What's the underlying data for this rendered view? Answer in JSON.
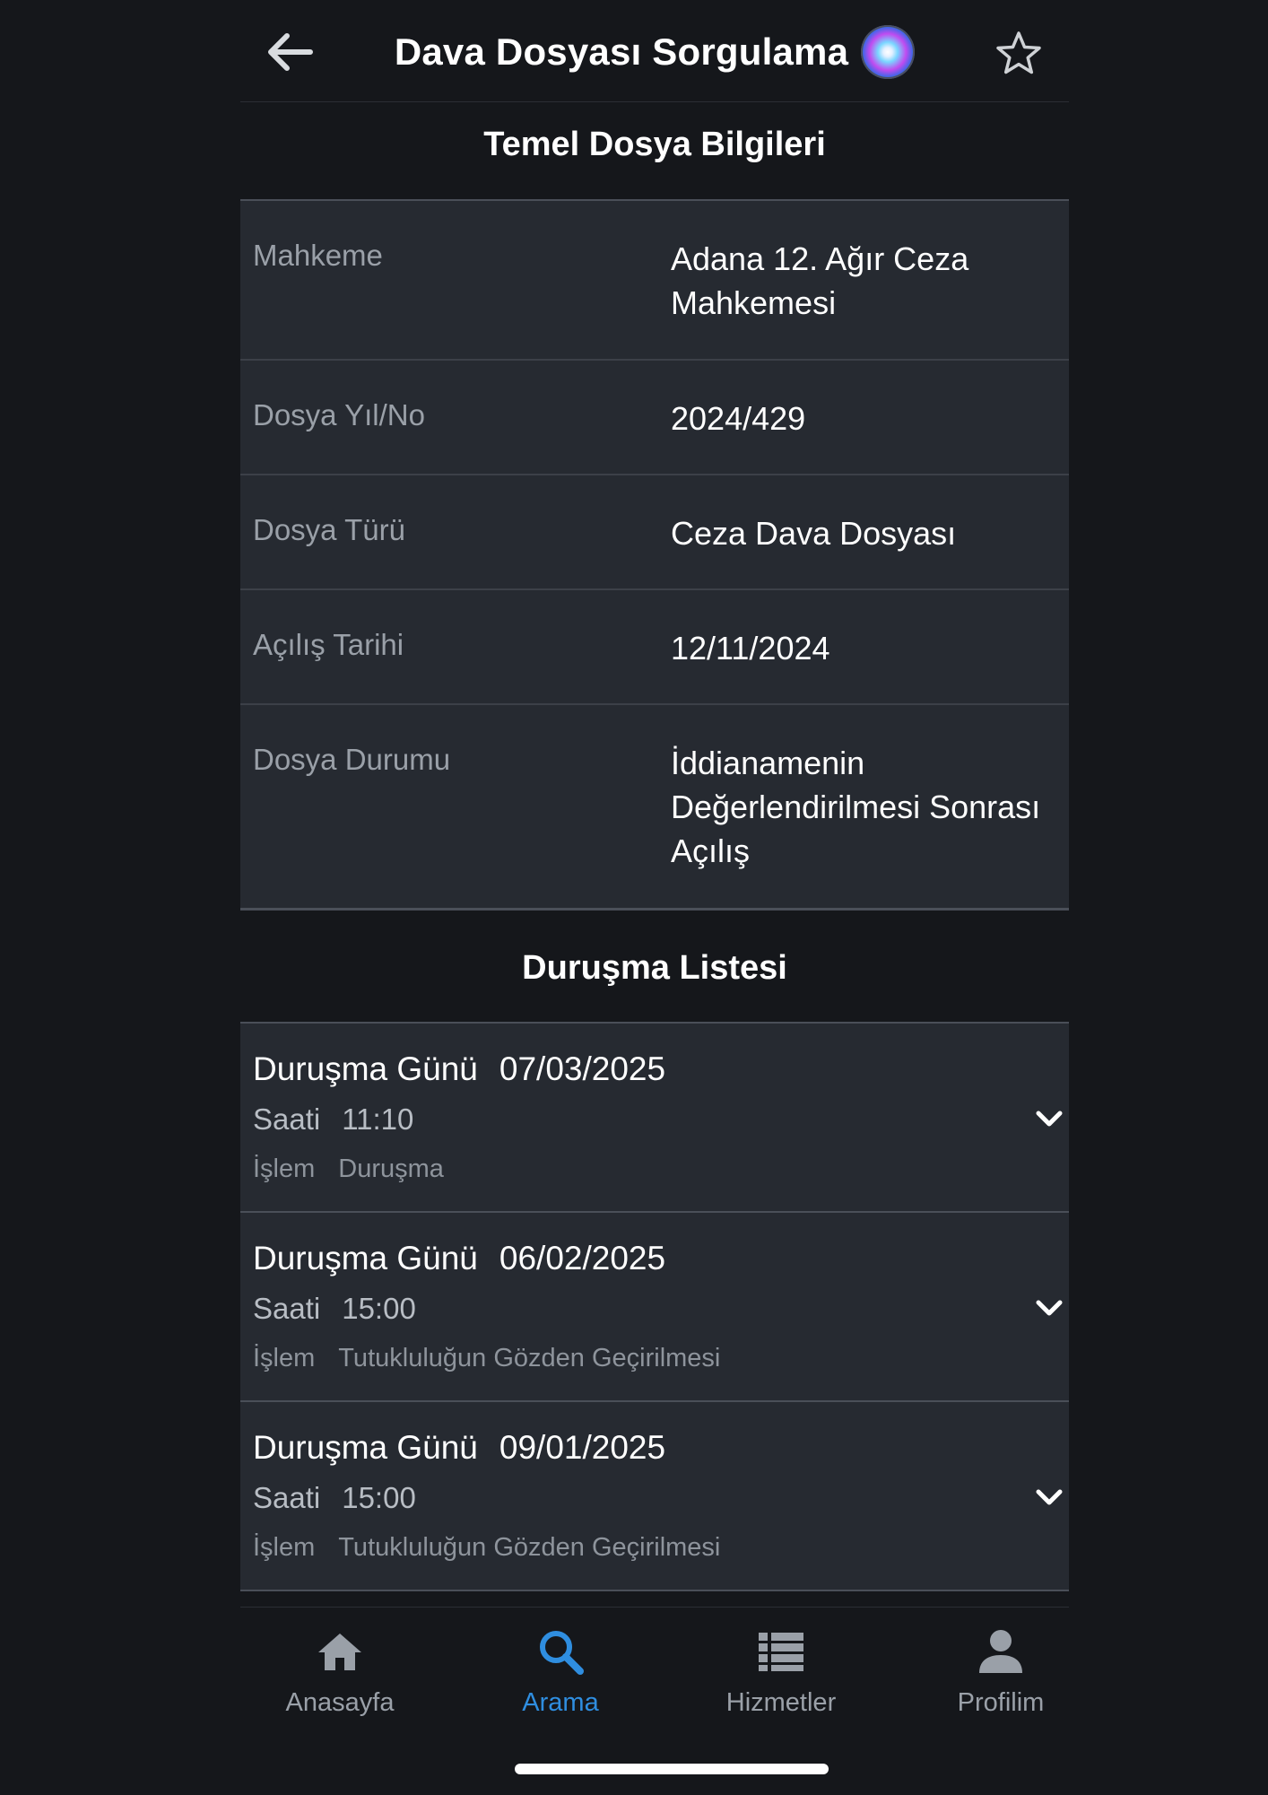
{
  "header": {
    "title": "Dava Dosyası Sorgulama",
    "back_icon": "arrow-left-icon",
    "siri_icon": "siri-icon",
    "favorite_icon": "star-outline-icon"
  },
  "basic_info": {
    "section_title": "Temel Dosya Bilgileri",
    "rows": [
      {
        "label": "Mahkeme",
        "value": "Adana 12. Ağır Ceza\nMahkemesi"
      },
      {
        "label": "Dosya Yıl/No",
        "value": "2024/429"
      },
      {
        "label": "Dosya Türü",
        "value": "Ceza Dava Dosyası"
      },
      {
        "label": "Açılış Tarihi",
        "value": "12/11/2024"
      },
      {
        "label": "Dosya Durumu",
        "value": "İddianamenin\nDeğerlendirilmesi Sonrası\nAçılış"
      }
    ]
  },
  "hearings": {
    "section_title": "Duruşma Listesi",
    "date_label": "Duruşma Günü",
    "time_label": "Saati",
    "action_label": "İşlem",
    "items": [
      {
        "date": "07/03/2025",
        "time": "11:10",
        "action": "Duruşma"
      },
      {
        "date": "06/02/2025",
        "time": "15:00",
        "action": "Tutukluluğun Gözden Geçirilmesi"
      },
      {
        "date": "09/01/2025",
        "time": "15:00",
        "action": "Tutukluluğun Gözden Geçirilmesi"
      }
    ]
  },
  "tabbar": {
    "active_color": "#2f8ee0",
    "tabs": [
      {
        "label": "Anasayfa",
        "icon": "home-icon"
      },
      {
        "label": "Arama",
        "icon": "search-icon",
        "active": true
      },
      {
        "label": "Hizmetler",
        "icon": "list-icon"
      },
      {
        "label": "Profilim",
        "icon": "person-icon"
      }
    ]
  }
}
